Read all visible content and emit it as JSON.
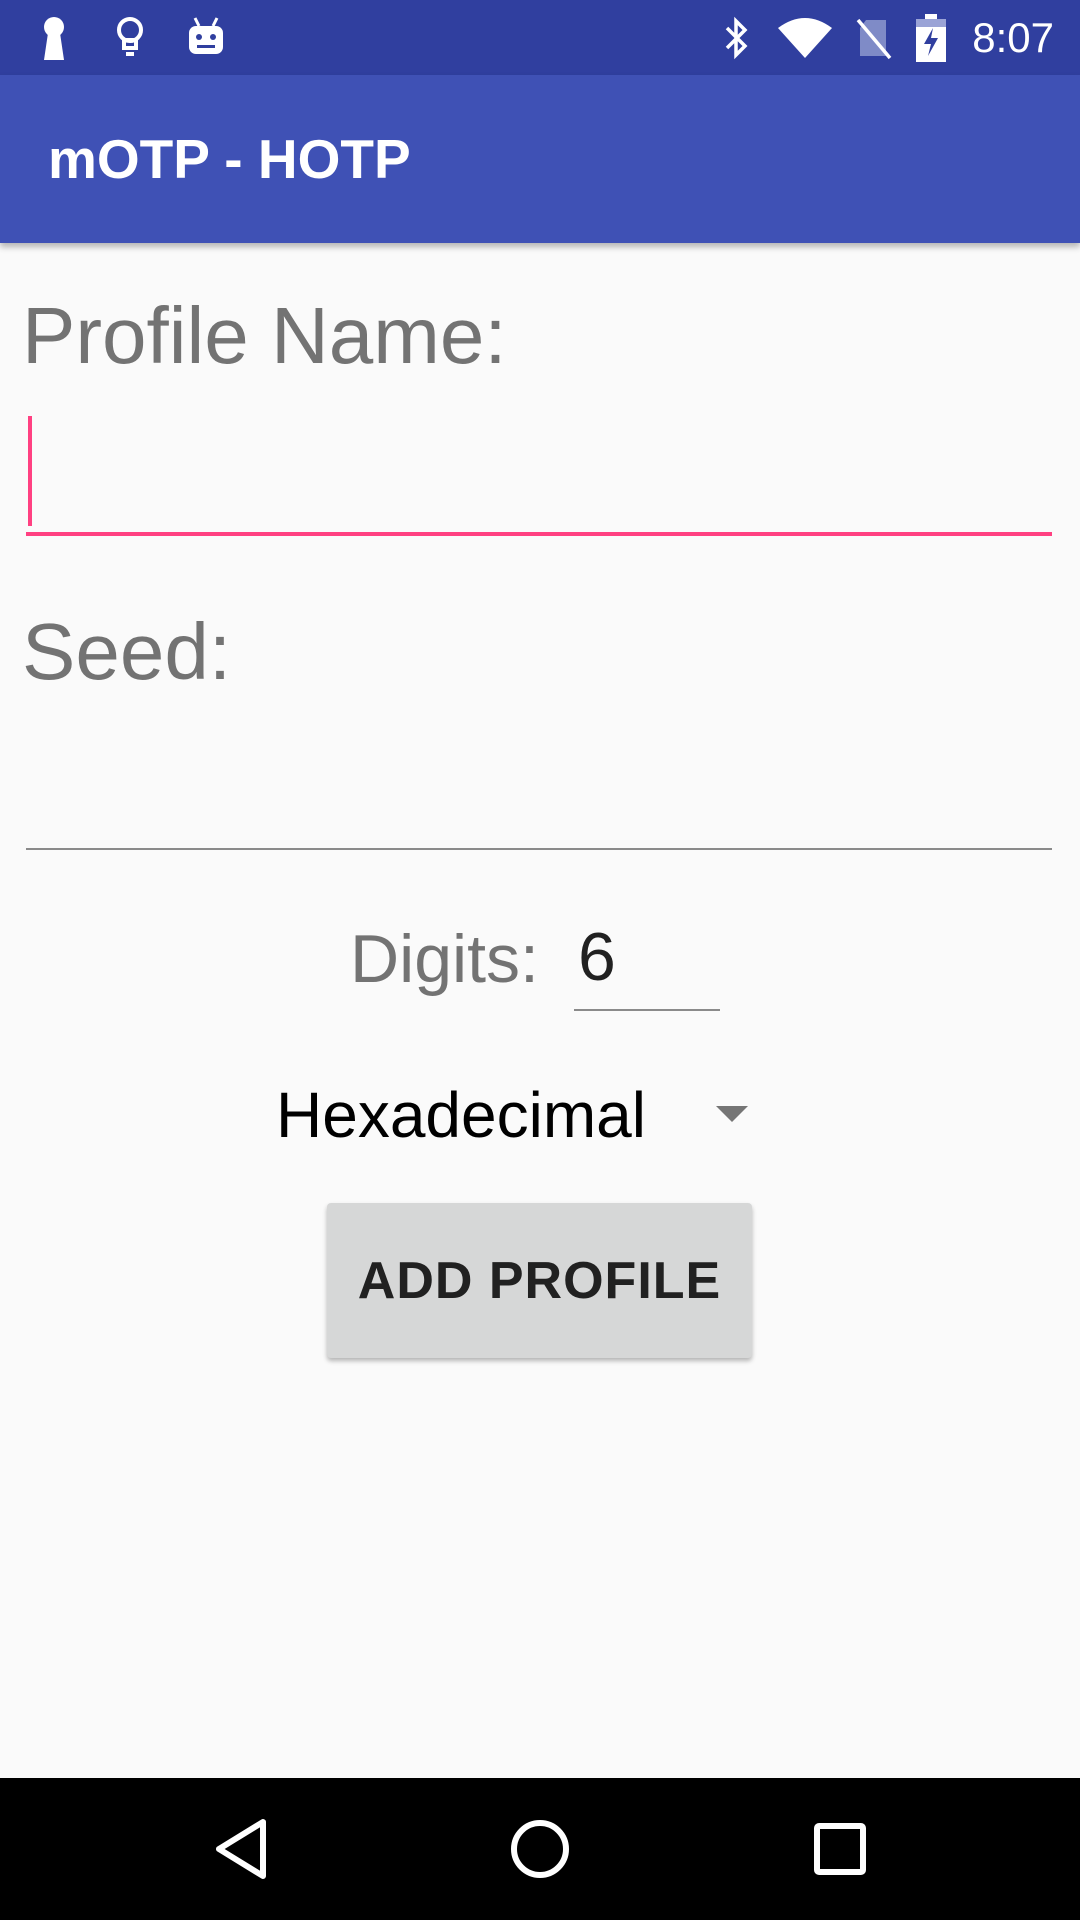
{
  "status_bar": {
    "time": "8:07",
    "left_icons": [
      "keyhole-icon",
      "lightbulb-icon",
      "android-icon"
    ],
    "right_icons": [
      "bluetooth-icon",
      "wifi-icon",
      "no-sim-icon",
      "battery-charging-icon"
    ]
  },
  "app_bar": {
    "title": "mOTP - HOTP"
  },
  "form": {
    "profile_label": "Profile Name:",
    "profile_value": "",
    "seed_label": "Seed:",
    "seed_value": "",
    "digits_label": "Digits:",
    "digits_value": "6",
    "encoding_selected": "Hexadecimal",
    "add_button_label": "ADD PROFILE"
  },
  "nav_bar": {
    "buttons": [
      "back-icon",
      "home-icon",
      "recents-icon"
    ]
  },
  "colors": {
    "status_bar": "#303f9f",
    "app_bar": "#3f51b5",
    "accent": "#ff4081",
    "background": "#fafafa"
  }
}
